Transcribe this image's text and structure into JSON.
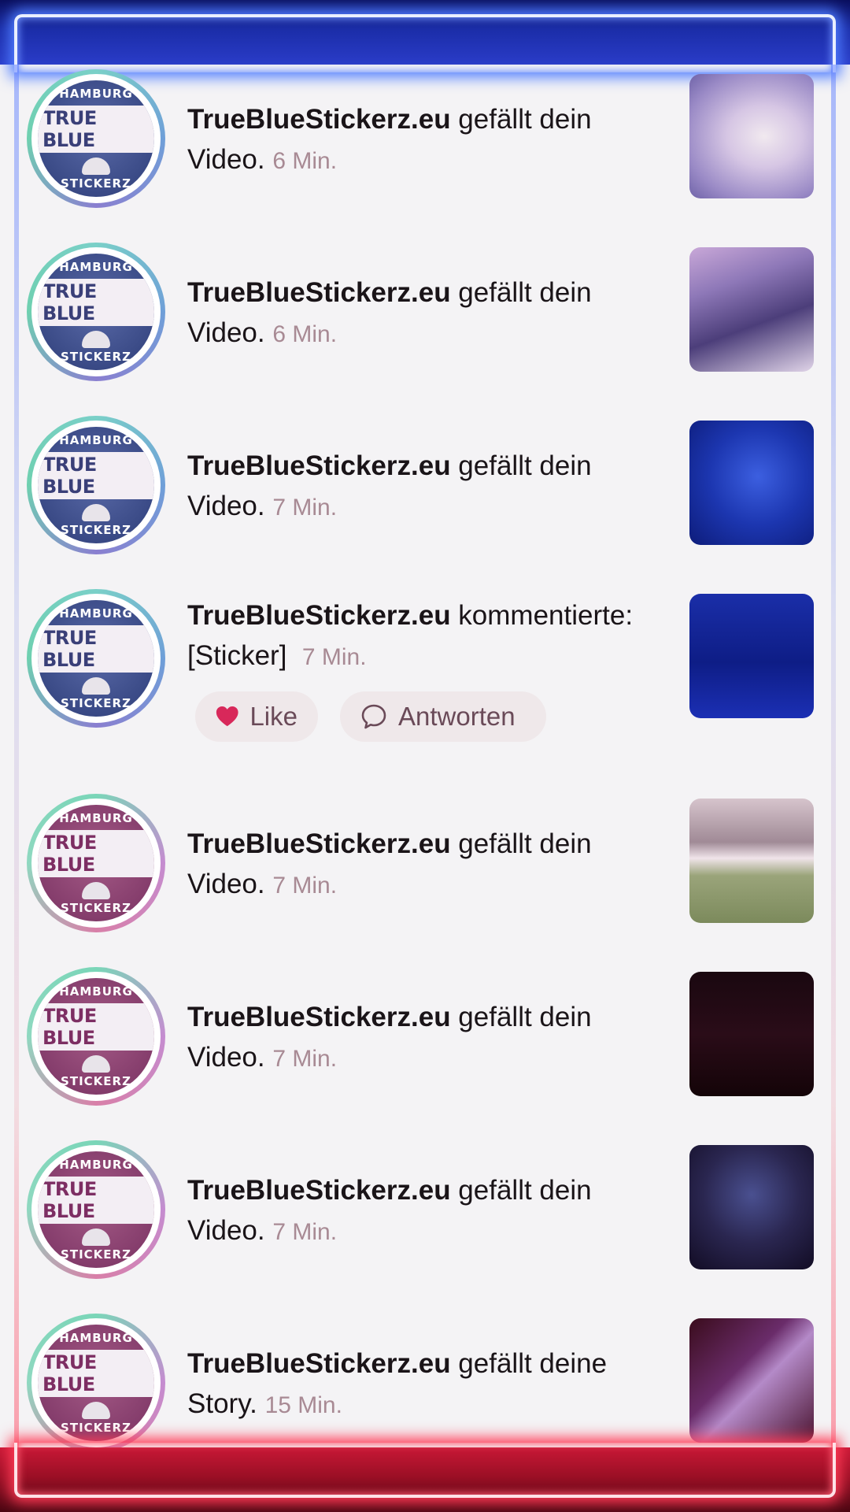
{
  "notifications": [
    {
      "user": "TrueBlueStickerz.eu",
      "action": " gefällt dein",
      "line2": "Video.",
      "time": "6 Min.",
      "avatar_tone": "blue",
      "thumb": "t1"
    },
    {
      "user": "TrueBlueStickerz.eu",
      "action": " gefällt dein",
      "line2": "Video.",
      "time": "6 Min.",
      "avatar_tone": "blue",
      "thumb": "t2"
    },
    {
      "user": "TrueBlueStickerz.eu",
      "action": " gefällt dein",
      "line2": "Video.",
      "time": "7 Min.",
      "avatar_tone": "blue",
      "thumb": "t3"
    },
    {
      "user": "TrueBlueStickerz.eu",
      "action": " kommentierte:",
      "line2": "[Sticker]",
      "time": "7 Min.",
      "avatar_tone": "blue",
      "thumb": "t4"
    },
    {
      "user": "TrueBlueStickerz.eu",
      "action": " gefällt dein",
      "line2": "Video.",
      "time": "7 Min.",
      "avatar_tone": "pink",
      "thumb": "t5"
    },
    {
      "user": "TrueBlueStickerz.eu",
      "action": " gefällt dein",
      "line2": "Video.",
      "time": "7 Min.",
      "avatar_tone": "pink",
      "thumb": "t6"
    },
    {
      "user": "TrueBlueStickerz.eu",
      "action": " gefällt dein",
      "line2": "Video.",
      "time": "7 Min.",
      "avatar_tone": "pink",
      "thumb": "t7"
    },
    {
      "user": "TrueBlueStickerz.eu",
      "action": " gefällt deine",
      "line2": "Story.",
      "time": "15 Min.",
      "avatar_tone": "pink",
      "thumb": "t8"
    }
  ],
  "avatar_badge": {
    "top": "HAMBURG",
    "main": "TRUE BLUE",
    "bottom": "STICKERZ"
  },
  "comment_actions": {
    "like_label": "Like",
    "reply_label": "Antworten"
  },
  "colors": {
    "neon_top": "#2a3cc8",
    "neon_bottom": "#c81836",
    "heart": "#d8285a"
  }
}
